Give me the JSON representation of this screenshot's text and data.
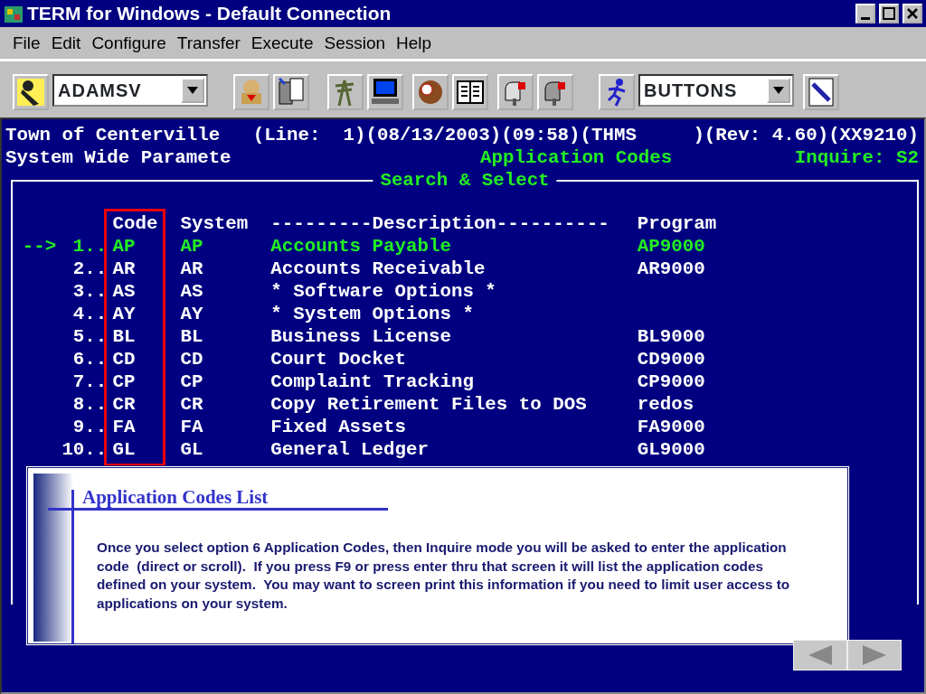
{
  "window": {
    "title": "TERM for Windows - Default Connection"
  },
  "menu": [
    "File",
    "Edit",
    "Configure",
    "Transfer",
    "Execute",
    "Session",
    "Help"
  ],
  "toolbar": {
    "combos": [
      "ADAMSV",
      "BUTTONS"
    ]
  },
  "terminal": {
    "header_left": "Town of Centerville",
    "header_right": "(Line:  1)(08/13/2003)(09:58)(THMS     )(Rev: 4.60)(XX9210)",
    "subtitle_left": "System Wide Paramete",
    "screen_title": "Application Codes",
    "mode": "Inquire: S2",
    "box_title": "Search & Select",
    "columns": [
      "Code",
      "System",
      "---------Description----------",
      "Program"
    ],
    "cursor": "-->",
    "rows": [
      {
        "number": "1..",
        "code": "AP",
        "system": "AP",
        "description": "Accounts Payable",
        "program": "AP9000",
        "selected": true
      },
      {
        "number": "2..",
        "code": "AR",
        "system": "AR",
        "description": "Accounts Receivable",
        "program": "AR9000",
        "selected": false
      },
      {
        "number": "3..",
        "code": "AS",
        "system": "AS",
        "description": "* Software Options *",
        "selected": false
      },
      {
        "number": "4..",
        "code": "AY",
        "system": "AY",
        "description": "* System Options *",
        "selected": false
      },
      {
        "number": "5..",
        "code": "BL",
        "system": "BL",
        "description": "Business License",
        "program": "BL9000",
        "selected": false
      },
      {
        "number": "6..",
        "code": "CD",
        "system": "CD",
        "description": "Court Docket",
        "program": "CD9000",
        "selected": false
      },
      {
        "number": "7..",
        "code": "CP",
        "system": "CP",
        "description": "Complaint Tracking",
        "program": "CP9000",
        "selected": false
      },
      {
        "number": "8..",
        "code": "CR",
        "system": "CR",
        "description": "Copy Retirement Files to DOS",
        "program": "redos",
        "selected": false
      },
      {
        "number": "9..",
        "code": "FA",
        "system": "FA",
        "description": "Fixed Assets",
        "program": "FA9000",
        "selected": false
      },
      {
        "number": "10..",
        "code": "GL",
        "system": "GL",
        "description": "General Ledger",
        "program": "GL9000",
        "selected": false
      }
    ]
  },
  "callout": {
    "title": "Application Codes List",
    "text": "Once you select option 6 Application Codes, then Inquire mode you will be asked to enter the application code  (direct or scroll).  If you press F9 or press enter thru that screen it will list the application codes defined on your system.  You may want to screen print this information if you need to limit user access to applications on your system."
  }
}
